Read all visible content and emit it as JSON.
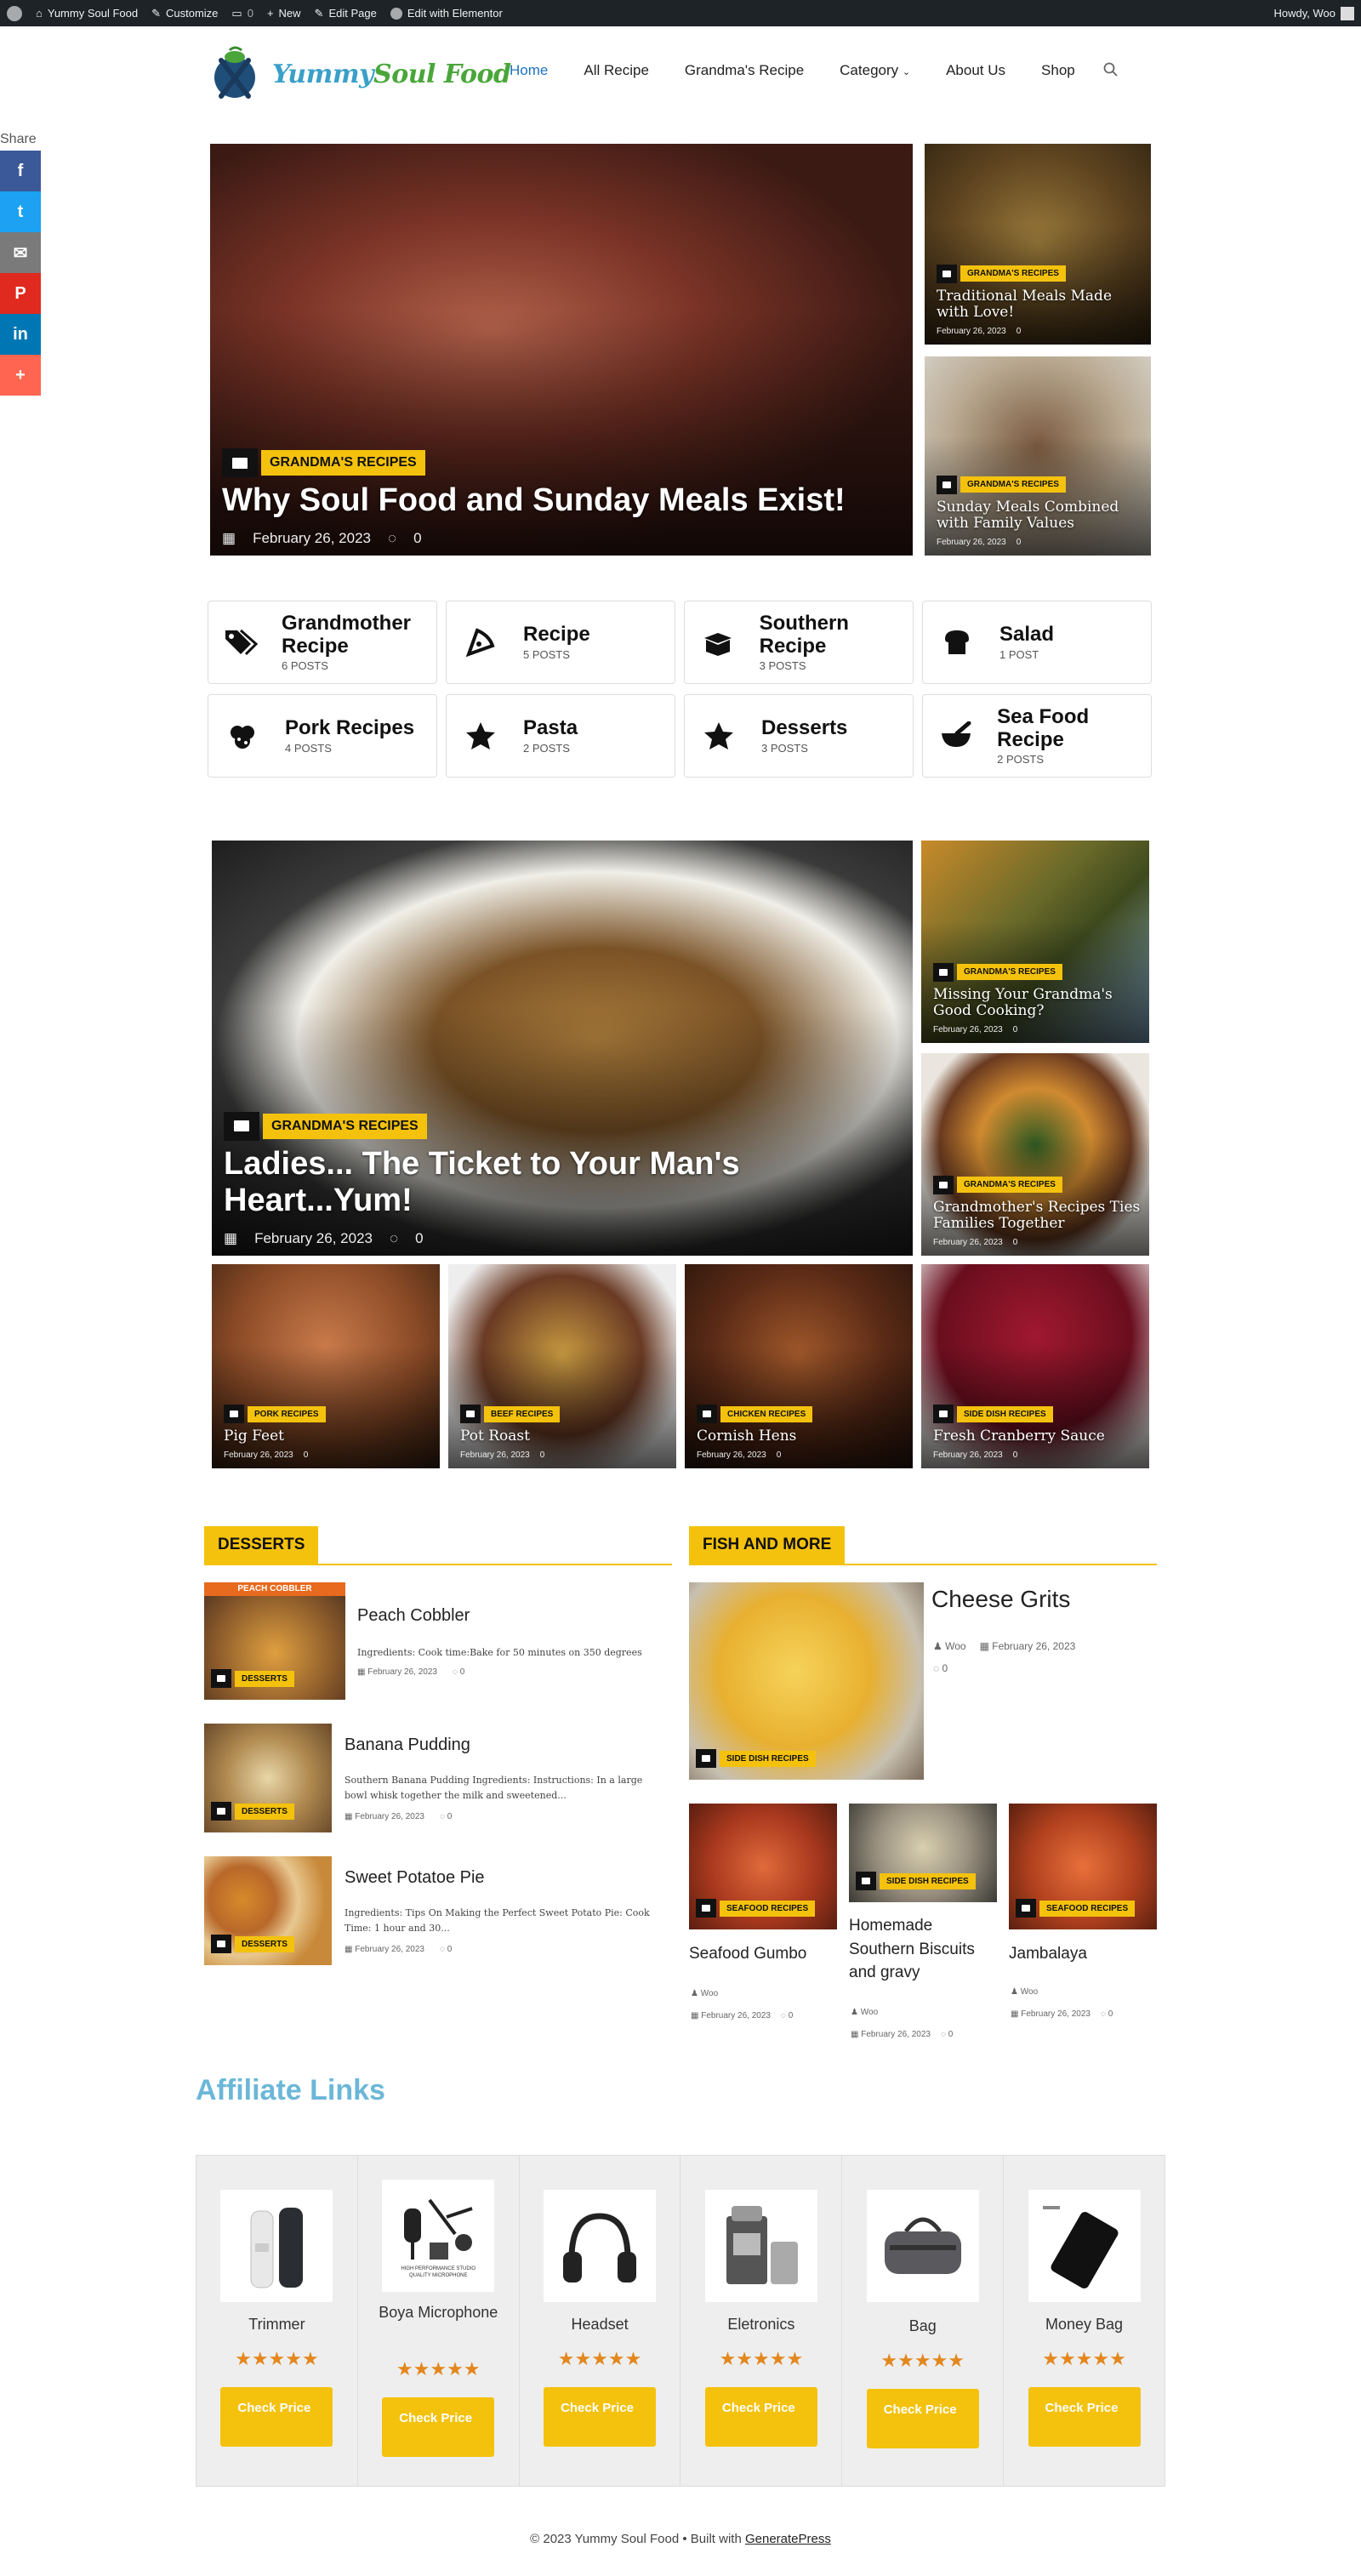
{
  "adminbar": {
    "site": "Yummy Soul Food",
    "customize": "Customize",
    "comments": "0",
    "new": "New",
    "edit_page": "Edit Page",
    "elementor": "Edit with Elementor",
    "howdy": "Howdy, Woo"
  },
  "logo": {
    "word1": "Yummy",
    "word2": "Soul Food"
  },
  "nav": [
    "Home",
    "All Recipe",
    "Grandma's Recipe",
    "Category",
    "About Us",
    "Shop"
  ],
  "share": {
    "label": "Share",
    "colors": [
      "#3b5998",
      "#1da1f2",
      "#7a7a7a",
      "#e02a20",
      "#0077b5",
      "#ff6550"
    ]
  },
  "hero1": {
    "main": {
      "badge": "GRANDMA'S RECIPES",
      "title": "Why Soul Food and Sunday Meals Exist!",
      "date": "February 26, 2023",
      "comments": "0"
    },
    "side": [
      {
        "badge": "GRANDMA'S RECIPES",
        "title": "Traditional Meals Made with Love!",
        "date": "February 26, 2023",
        "comments": "0"
      },
      {
        "badge": "GRANDMA'S RECIPES",
        "title": "Sunday Meals Combined with Family Values",
        "date": "February 26, 2023",
        "comments": "0"
      }
    ]
  },
  "categories": [
    {
      "name": "Grandmother Recipe",
      "count": "6 POSTS",
      "icon": "tags-icon"
    },
    {
      "name": "Recipe",
      "count": "5 POSTS",
      "icon": "pizza-icon"
    },
    {
      "name": "Southern Recipe",
      "count": "3 POSTS",
      "icon": "box-open-icon"
    },
    {
      "name": "Salad",
      "count": "1 POST",
      "icon": "bread-icon"
    },
    {
      "name": "Pork Recipes",
      "count": "4 POSTS",
      "icon": "cookie-icon"
    },
    {
      "name": "Pasta",
      "count": "2 POSTS",
      "icon": "star-icon"
    },
    {
      "name": "Desserts",
      "count": "3 POSTS",
      "icon": "star-icon"
    },
    {
      "name": "Sea Food Recipe",
      "count": "2 POSTS",
      "icon": "mortar-icon"
    }
  ],
  "hero2": {
    "main": {
      "badge": "GRANDMA'S RECIPES",
      "title": "Ladies... The Ticket to Your Man's Heart...Yum!",
      "date": "February 26, 2023",
      "comments": "0"
    },
    "side": [
      {
        "badge": "GRANDMA'S RECIPES",
        "title": "Missing Your Grandma's Good Cooking?",
        "date": "February 26, 2023",
        "comments": "0"
      },
      {
        "badge": "GRANDMA'S RECIPES",
        "title": "Grandmother's Recipes Ties Families Together",
        "date": "February 26, 2023",
        "comments": "0"
      }
    ],
    "bottom": [
      {
        "badge": "PORK RECIPES",
        "title": "Pig Feet",
        "date": "February 26, 2023",
        "comments": "0"
      },
      {
        "badge": "BEEF RECIPES",
        "title": "Pot Roast",
        "date": "February 26, 2023",
        "comments": "0"
      },
      {
        "badge": "CHICKEN RECIPES",
        "title": "Cornish Hens",
        "date": "February 26, 2023",
        "comments": "0"
      },
      {
        "badge": "SIDE DISH RECIPES",
        "title": "Fresh Cranberry Sauce",
        "date": "February 26, 2023",
        "comments": "0"
      }
    ]
  },
  "desserts": {
    "heading": "DESSERTS",
    "thumb_text": "PEACH COBBLER",
    "posts": [
      {
        "badge": "DESSERTS",
        "title": "Peach Cobbler",
        "excerpt": "Ingredients: Cook time:Bake for 50 minutes on 350 degrees",
        "date": "February 26, 2023",
        "comments": "0"
      },
      {
        "badge": "DESSERTS",
        "title": "Banana Pudding",
        "excerpt": "Southern Banana Pudding Ingredients: Instructions: In a large bowl whisk together the milk and sweetened...",
        "date": "February 26, 2023",
        "comments": "0"
      },
      {
        "badge": "DESSERTS",
        "title": "Sweet Potatoe Pie",
        "excerpt": "Ingredients: Tips On Making the Perfect Sweet Potato Pie: Cook Time: 1 hour and 30...",
        "date": "February 26, 2023",
        "comments": "0"
      }
    ]
  },
  "fish": {
    "heading": "FISH AND MORE",
    "feature": {
      "badge": "SIDE DISH RECIPES",
      "title": "Cheese Grits",
      "author": "Woo",
      "date": "February 26, 2023",
      "comments": "0"
    },
    "posts": [
      {
        "badge": "SEAFOOD RECIPES",
        "title": "Seafood Gumbo",
        "author": "Woo",
        "date": "February 26, 2023",
        "comments": "0"
      },
      {
        "badge": "SIDE DISH RECIPES",
        "title": "Homemade Southern Biscuits and gravy",
        "author": "Woo",
        "date": "February 26, 2023",
        "comments": "0"
      },
      {
        "badge": "SEAFOOD RECIPES",
        "title": "Jambalaya",
        "author": "Woo",
        "date": "February 26, 2023",
        "comments": "0"
      }
    ]
  },
  "affiliate": {
    "title": "Affiliate Links",
    "stars": "★★★★★",
    "button": "Check Price",
    "products": [
      {
        "name": "Trimmer"
      },
      {
        "name": "Boya Microphone",
        "img_text": "HIGH PERFORMANCE STUDIO QUALITY MICROPHONE"
      },
      {
        "name": "Headset"
      },
      {
        "name": "Eletronics"
      },
      {
        "name": "Bag"
      },
      {
        "name": "Money Bag"
      }
    ]
  },
  "footer": {
    "text": "© 2023 Yummy Soul Food • Built with",
    "link": "GeneratePress"
  },
  "colors": {
    "accent": "#f4c20d",
    "link": "#1e73be",
    "affiliate_title": "#6cb7d8",
    "admin_bar": "#1d2327"
  }
}
